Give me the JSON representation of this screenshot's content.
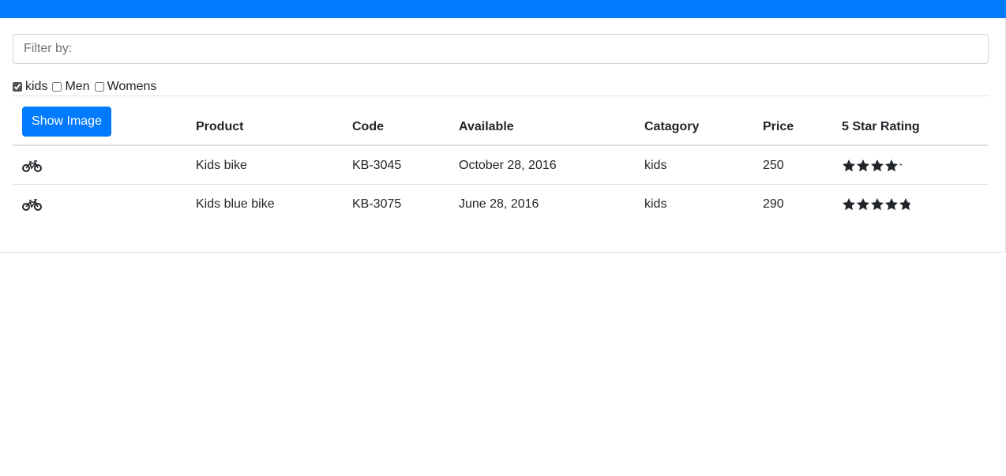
{
  "filter": {
    "placeholder": "Filter by:"
  },
  "categories": [
    {
      "label": "kids",
      "checked": true
    },
    {
      "label": "Men",
      "checked": false
    },
    {
      "label": "Womens",
      "checked": false
    }
  ],
  "table": {
    "show_image_label": "Show Image",
    "headers": [
      "Product",
      "Code",
      "Available",
      "Catagory",
      "Price",
      "5 Star Rating"
    ],
    "rows": [
      {
        "icon": "bike-icon",
        "product": "Kids bike",
        "code": "KB-3045",
        "available": "October 28, 2016",
        "category": "kids",
        "price": "250",
        "rating": 4.2
      },
      {
        "icon": "bike-icon",
        "product": "Kids blue bike",
        "code": "KB-3075",
        "available": "June 28, 2016",
        "category": "kids",
        "price": "290",
        "rating": 4.8
      }
    ]
  },
  "colors": {
    "accent": "#007bff",
    "star": "#212529"
  }
}
